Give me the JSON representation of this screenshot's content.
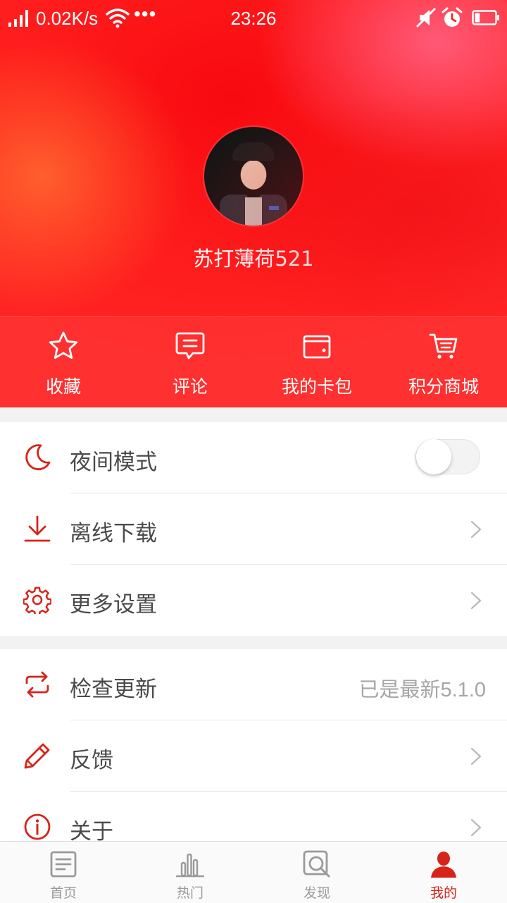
{
  "status_bar": {
    "network_speed": "0.02K/s",
    "overflow": "•••",
    "time": "23:26",
    "icons": [
      "signal-icon",
      "wifi-icon",
      "mute-icon",
      "alarm-icon",
      "battery-icon"
    ],
    "battery_level": 0.25
  },
  "profile": {
    "username": "苏打薄荷521"
  },
  "quick_actions": [
    {
      "label": "收藏",
      "icon": "star-icon"
    },
    {
      "label": "评论",
      "icon": "comment-icon"
    },
    {
      "label": "我的卡包",
      "icon": "wallet-icon"
    },
    {
      "label": "积分商城",
      "icon": "cart-icon"
    }
  ],
  "settings_group": [
    {
      "label": "夜间模式",
      "icon": "moon-icon",
      "control": "toggle",
      "toggle_on": false
    },
    {
      "label": "离线下载",
      "icon": "download-icon",
      "control": "chevron"
    },
    {
      "label": "更多设置",
      "icon": "gear-icon",
      "control": "chevron"
    }
  ],
  "info_group": [
    {
      "label": "检查更新",
      "icon": "refresh-icon",
      "value_prefix": "已是最新",
      "value_version": "5.1.0"
    },
    {
      "label": "反馈",
      "icon": "pencil-icon",
      "control": "chevron"
    },
    {
      "label": "关于",
      "icon": "info-icon",
      "control": "chevron"
    }
  ],
  "tabs": [
    {
      "label": "首页",
      "icon": "news-icon",
      "active": false
    },
    {
      "label": "热门",
      "icon": "chart-icon",
      "active": false
    },
    {
      "label": "发现",
      "icon": "discover-icon",
      "active": false
    },
    {
      "label": "我的",
      "icon": "user-icon",
      "active": true
    }
  ],
  "colors": {
    "accent": "#d6241b",
    "header_red": "#ff1c1c",
    "text": "#4a4a4a",
    "muted": "#a6a6a6",
    "tab_inactive": "#9a9a9a"
  }
}
